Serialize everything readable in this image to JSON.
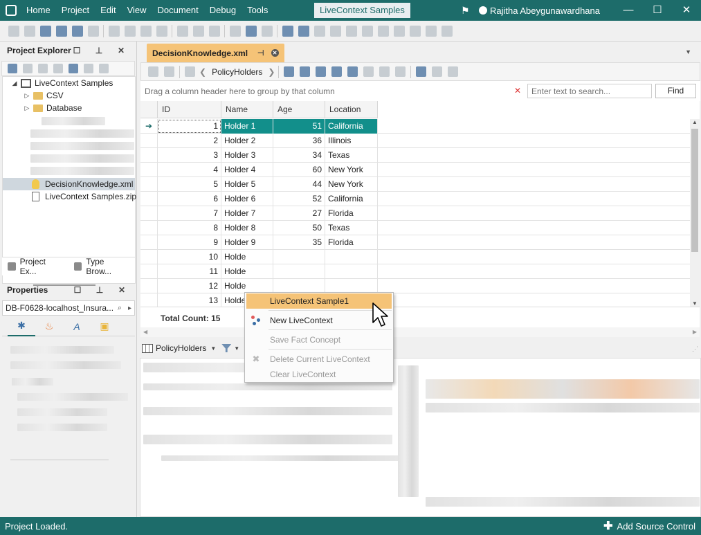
{
  "titlebar": {
    "menu": [
      "Home",
      "Project",
      "Edit",
      "View",
      "Document",
      "Debug",
      "Tools"
    ],
    "center_title": "LiveContext Samples",
    "user_name": "Rajitha Abeygunawardhana",
    "controls": {
      "minimize": "—",
      "maximize": "☐",
      "close": "✕"
    }
  },
  "project_explorer": {
    "title": "Project Explorer",
    "tree": {
      "root": "LiveContext Samples",
      "folders": [
        "CSV",
        "Database"
      ],
      "selected_file": "DecisionKnowledge.xml",
      "zip_file": "LiveContext Samples.zip"
    },
    "tabs": [
      "Project Ex...",
      "Type Brow..."
    ]
  },
  "properties": {
    "title": "Properties",
    "combo_value": "DB-F0628-localhost_Insura..."
  },
  "document": {
    "tab_title": "DecisionKnowledge.xml",
    "nav_label": "PolicyHolders",
    "group_hint": "Drag a column header here to group by that column",
    "search_placeholder": "Enter text to search...",
    "find_label": "Find",
    "columns": [
      "ID",
      "Name",
      "Age",
      "Location"
    ],
    "rows": [
      [
        "1",
        "Holder 1",
        "51",
        "California"
      ],
      [
        "2",
        "Holder 2",
        "36",
        "Illinois"
      ],
      [
        "3",
        "Holder 3",
        "34",
        "Texas"
      ],
      [
        "4",
        "Holder 4",
        "60",
        "New York"
      ],
      [
        "5",
        "Holder 5",
        "44",
        "New York"
      ],
      [
        "6",
        "Holder 6",
        "52",
        "California"
      ],
      [
        "7",
        "Holder 7",
        "27",
        "Florida"
      ],
      [
        "8",
        "Holder 8",
        "50",
        "Texas"
      ],
      [
        "9",
        "Holder 9",
        "35",
        "Florida"
      ],
      [
        "10",
        "Holde",
        "",
        ""
      ],
      [
        "11",
        "Holde",
        "",
        ""
      ],
      [
        "12",
        "Holde",
        "",
        ""
      ],
      [
        "13",
        "Holde",
        "",
        ""
      ]
    ],
    "total_count": "Total Count: 15",
    "lower_toolbar_label": "PolicyHolders"
  },
  "context_menu": {
    "items": [
      {
        "label": "LiveContext Sample1",
        "state": "highlighted"
      },
      {
        "label": "New LiveContext",
        "state": "enabled"
      },
      {
        "label": "Save Fact Concept",
        "state": "disabled"
      },
      {
        "label": "Delete Current LiveContext",
        "state": "disabled"
      },
      {
        "label": "Clear LiveContext",
        "state": "disabled"
      }
    ]
  },
  "statusbar": {
    "status_text": "Project Loaded.",
    "source_control": "Add Source Control"
  },
  "colors": {
    "titlebar": "#1d6c6a",
    "selection": "#128f8b",
    "tab_highlight": "#f5c377"
  }
}
